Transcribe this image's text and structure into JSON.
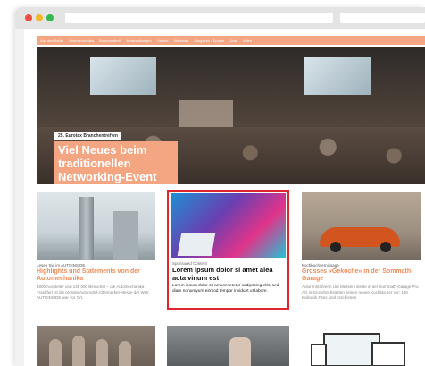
{
  "nav": {
    "items": [
      "Aus den Reihe",
      "Automechanika",
      "Branchentreff",
      "Veranstaltungen",
      "Handel",
      "Werkstatt",
      "Ausgaben / Epaper",
      "Jobs",
      "Video"
    ]
  },
  "hero": {
    "kicker": "25. Eurotax Branchentreffen",
    "title": "Viel Neues beim traditionellen Networking-Event"
  },
  "cards": [
    {
      "kicker": "Lesen Sie im AUTOINSIDE",
      "title": "Highlights und Statements von der Automechanika",
      "teaser": "4800 Aussteller und 136 000 Besucher – die Automechanika Frankfurt ist die grösste Automobil-Aftermarket-Messe der Welt. AUTOINSIDE war vor Ort."
    },
    {
      "kicker": "Sponsored Content",
      "title": "Lorem ipsum dolor si amet alea acta vinum est",
      "teaser": "Lorem ipsum dolor sit amconsetetur sadipscing elitr, sed diam nonumyum eirmod tempor invidunt ut labore."
    },
    {
      "kicker": "Kochbuchvernissage",
      "title": "Grosses «Gekoche» in der Sommath-Garage",
      "teaser": "Autorennfahrerin Urs Messerli stellte in der Sommath-Garage Pro AG in Grosshöchstetten seinen neuen Kochbücher vor: 130 Kulinarik Fans sind erschienen."
    }
  ],
  "colors": {
    "accent": "#f4a582",
    "headline": "#f28a55",
    "highlight_border": "#e0262c"
  }
}
